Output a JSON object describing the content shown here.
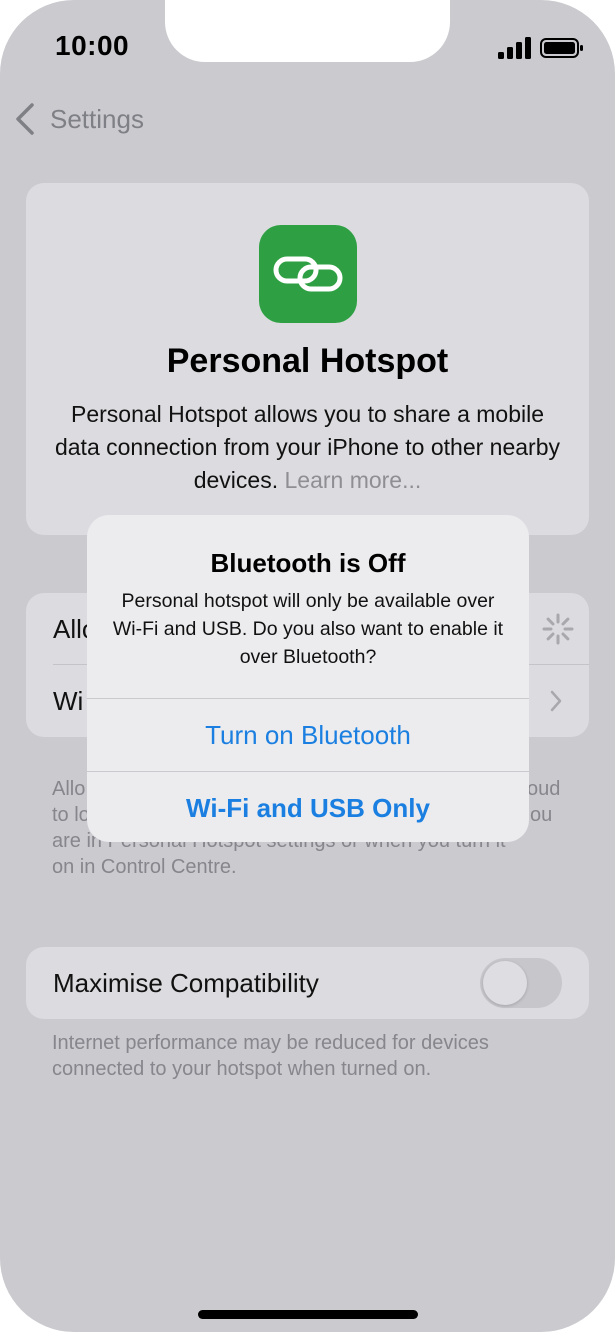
{
  "status_bar": {
    "time": "10:00"
  },
  "nav": {
    "back_label": "Settings"
  },
  "hero": {
    "title": "Personal Hotspot",
    "description": "Personal Hotspot allows you to share a mobile data connection from your iPhone to other nearby devices.",
    "learn_more": "Learn more..."
  },
  "settings_rows": [
    {
      "label": "Allo"
    },
    {
      "label": "Wi"
    }
  ],
  "footnote_allow": [
    {
      "text": "Allo"
    },
    {
      "text": "to lo"
    },
    {
      "text": "are in Personal Hotspot settings or when you turn it"
    },
    {
      "text": "on in Control Centre."
    }
  ],
  "footnote_right": [
    {
      "text": "oud"
    },
    {
      "text": "ou"
    }
  ],
  "compat": {
    "label": "Maximise Compatibility",
    "enabled": false,
    "footnote": "Internet performance may be reduced for devices connected to your hotspot when turned on."
  },
  "alert": {
    "title": "Bluetooth is Off",
    "message": "Personal hotspot will only be available over Wi-Fi and USB. Do you also want to enable it over Bluetooth?",
    "primary_button": "Turn on Bluetooth",
    "secondary_button": "Wi-Fi and USB Only"
  },
  "colors": {
    "accent": "#1a7fe0",
    "app_icon": "#2ea043",
    "dimmed_background": "#cacacf"
  },
  "icons": [
    "signal-icon",
    "battery-icon",
    "back-chevron-icon",
    "hotspot-link-icon",
    "loading-spinner-icon",
    "chevron-right-icon"
  ]
}
